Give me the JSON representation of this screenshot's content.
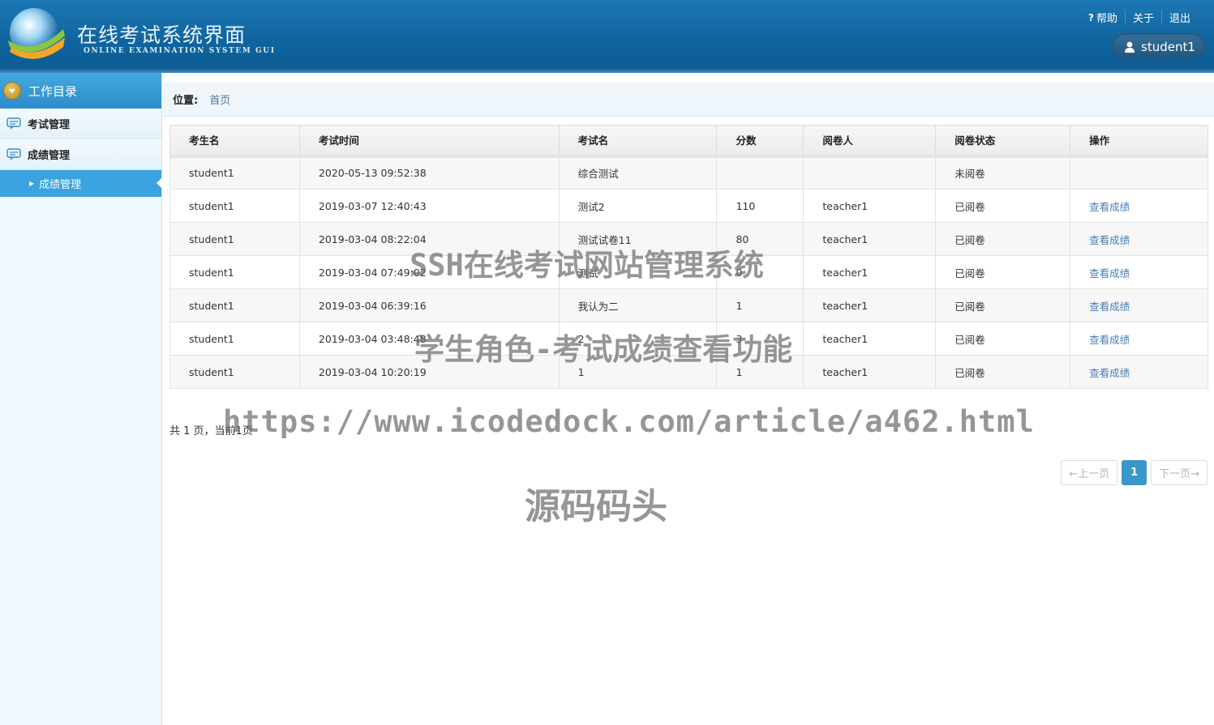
{
  "header": {
    "title": "在线考试系统界面",
    "subtitle": "ONLINE EXAMINATION SYSTEM GUI",
    "links": {
      "help": "帮助",
      "about": "关于",
      "logout": "退出"
    },
    "user": "student1"
  },
  "sidebar": {
    "title": "工作目录",
    "items": [
      {
        "label": "考试管理"
      },
      {
        "label": "成绩管理"
      }
    ],
    "active_sub": "成绩管理"
  },
  "breadcrumb": {
    "label": "位置:",
    "home": "首页"
  },
  "table": {
    "headers": [
      "考生名",
      "考试时间",
      "考试名",
      "分数",
      "阅卷人",
      "阅卷状态",
      "操作"
    ],
    "rows": [
      [
        "student1",
        "2020-05-13 09:52:38",
        "综合测试",
        "",
        "",
        "未阅卷",
        ""
      ],
      [
        "student1",
        "2019-03-07 12:40:43",
        "测试2",
        "110",
        "teacher1",
        "已阅卷",
        "查看成绩"
      ],
      [
        "student1",
        "2019-03-04 08:22:04",
        "测试试卷11",
        "80",
        "teacher1",
        "已阅卷",
        "查看成绩"
      ],
      [
        "student1",
        "2019-03-04 07:49:02",
        "测试",
        "0",
        "teacher1",
        "已阅卷",
        "查看成绩"
      ],
      [
        "student1",
        "2019-03-04 06:39:16",
        "我认为二",
        "1",
        "teacher1",
        "已阅卷",
        "查看成绩"
      ],
      [
        "student1",
        "2019-03-04 03:48:48",
        "2",
        "3",
        "teacher1",
        "已阅卷",
        "查看成绩"
      ],
      [
        "student1",
        "2019-03-04 10:20:19",
        "1",
        "1",
        "teacher1",
        "已阅卷",
        "查看成绩"
      ]
    ]
  },
  "pagination": {
    "info": "共 1 页，当前1页",
    "prev": "←上一页",
    "current": "1",
    "next": "下一页→"
  },
  "watermark": {
    "line1": "SSH在线考试网站管理系统",
    "line2": "学生角色-考试成绩查看功能",
    "line3": "https://www.icodedock.com/article/a462.html",
    "line4": "源码码头"
  },
  "colors": {
    "header_bg": "#10659f",
    "sidebar_active": "#3aa3e0",
    "link": "#4a7fb5",
    "pager_current": "#3a97c9"
  }
}
